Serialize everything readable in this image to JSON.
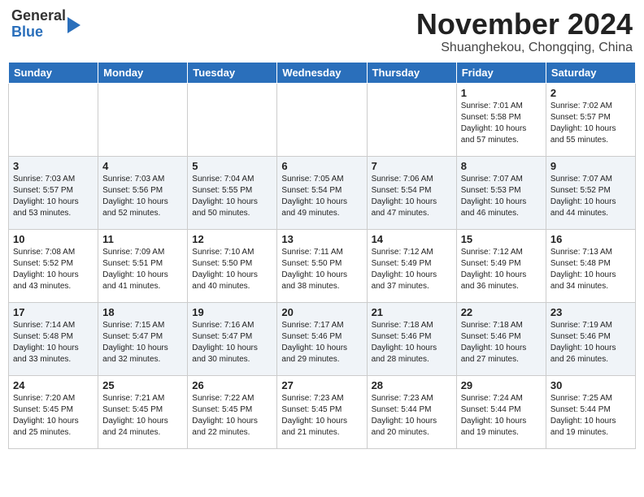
{
  "header": {
    "logo_line1": "General",
    "logo_line2": "Blue",
    "title": "November 2024",
    "subtitle": "Shuanghekou, Chongqing, China"
  },
  "weekdays": [
    "Sunday",
    "Monday",
    "Tuesday",
    "Wednesday",
    "Thursday",
    "Friday",
    "Saturday"
  ],
  "weeks": [
    [
      {
        "day": "",
        "info": ""
      },
      {
        "day": "",
        "info": ""
      },
      {
        "day": "",
        "info": ""
      },
      {
        "day": "",
        "info": ""
      },
      {
        "day": "",
        "info": ""
      },
      {
        "day": "1",
        "info": "Sunrise: 7:01 AM\nSunset: 5:58 PM\nDaylight: 10 hours and 57 minutes."
      },
      {
        "day": "2",
        "info": "Sunrise: 7:02 AM\nSunset: 5:57 PM\nDaylight: 10 hours and 55 minutes."
      }
    ],
    [
      {
        "day": "3",
        "info": "Sunrise: 7:03 AM\nSunset: 5:57 PM\nDaylight: 10 hours and 53 minutes."
      },
      {
        "day": "4",
        "info": "Sunrise: 7:03 AM\nSunset: 5:56 PM\nDaylight: 10 hours and 52 minutes."
      },
      {
        "day": "5",
        "info": "Sunrise: 7:04 AM\nSunset: 5:55 PM\nDaylight: 10 hours and 50 minutes."
      },
      {
        "day": "6",
        "info": "Sunrise: 7:05 AM\nSunset: 5:54 PM\nDaylight: 10 hours and 49 minutes."
      },
      {
        "day": "7",
        "info": "Sunrise: 7:06 AM\nSunset: 5:54 PM\nDaylight: 10 hours and 47 minutes."
      },
      {
        "day": "8",
        "info": "Sunrise: 7:07 AM\nSunset: 5:53 PM\nDaylight: 10 hours and 46 minutes."
      },
      {
        "day": "9",
        "info": "Sunrise: 7:07 AM\nSunset: 5:52 PM\nDaylight: 10 hours and 44 minutes."
      }
    ],
    [
      {
        "day": "10",
        "info": "Sunrise: 7:08 AM\nSunset: 5:52 PM\nDaylight: 10 hours and 43 minutes."
      },
      {
        "day": "11",
        "info": "Sunrise: 7:09 AM\nSunset: 5:51 PM\nDaylight: 10 hours and 41 minutes."
      },
      {
        "day": "12",
        "info": "Sunrise: 7:10 AM\nSunset: 5:50 PM\nDaylight: 10 hours and 40 minutes."
      },
      {
        "day": "13",
        "info": "Sunrise: 7:11 AM\nSunset: 5:50 PM\nDaylight: 10 hours and 38 minutes."
      },
      {
        "day": "14",
        "info": "Sunrise: 7:12 AM\nSunset: 5:49 PM\nDaylight: 10 hours and 37 minutes."
      },
      {
        "day": "15",
        "info": "Sunrise: 7:12 AM\nSunset: 5:49 PM\nDaylight: 10 hours and 36 minutes."
      },
      {
        "day": "16",
        "info": "Sunrise: 7:13 AM\nSunset: 5:48 PM\nDaylight: 10 hours and 34 minutes."
      }
    ],
    [
      {
        "day": "17",
        "info": "Sunrise: 7:14 AM\nSunset: 5:48 PM\nDaylight: 10 hours and 33 minutes."
      },
      {
        "day": "18",
        "info": "Sunrise: 7:15 AM\nSunset: 5:47 PM\nDaylight: 10 hours and 32 minutes."
      },
      {
        "day": "19",
        "info": "Sunrise: 7:16 AM\nSunset: 5:47 PM\nDaylight: 10 hours and 30 minutes."
      },
      {
        "day": "20",
        "info": "Sunrise: 7:17 AM\nSunset: 5:46 PM\nDaylight: 10 hours and 29 minutes."
      },
      {
        "day": "21",
        "info": "Sunrise: 7:18 AM\nSunset: 5:46 PM\nDaylight: 10 hours and 28 minutes."
      },
      {
        "day": "22",
        "info": "Sunrise: 7:18 AM\nSunset: 5:46 PM\nDaylight: 10 hours and 27 minutes."
      },
      {
        "day": "23",
        "info": "Sunrise: 7:19 AM\nSunset: 5:46 PM\nDaylight: 10 hours and 26 minutes."
      }
    ],
    [
      {
        "day": "24",
        "info": "Sunrise: 7:20 AM\nSunset: 5:45 PM\nDaylight: 10 hours and 25 minutes."
      },
      {
        "day": "25",
        "info": "Sunrise: 7:21 AM\nSunset: 5:45 PM\nDaylight: 10 hours and 24 minutes."
      },
      {
        "day": "26",
        "info": "Sunrise: 7:22 AM\nSunset: 5:45 PM\nDaylight: 10 hours and 22 minutes."
      },
      {
        "day": "27",
        "info": "Sunrise: 7:23 AM\nSunset: 5:45 PM\nDaylight: 10 hours and 21 minutes."
      },
      {
        "day": "28",
        "info": "Sunrise: 7:23 AM\nSunset: 5:44 PM\nDaylight: 10 hours and 20 minutes."
      },
      {
        "day": "29",
        "info": "Sunrise: 7:24 AM\nSunset: 5:44 PM\nDaylight: 10 hours and 19 minutes."
      },
      {
        "day": "30",
        "info": "Sunrise: 7:25 AM\nSunset: 5:44 PM\nDaylight: 10 hours and 19 minutes."
      }
    ]
  ]
}
